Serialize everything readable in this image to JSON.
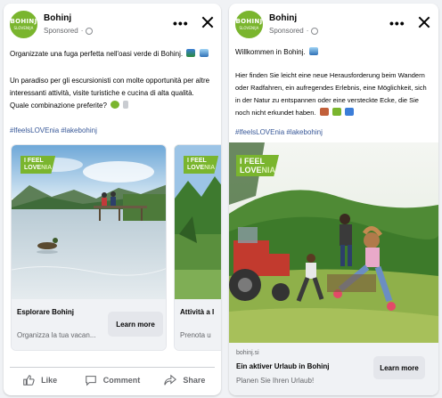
{
  "colors": {
    "brand": "#7ab52e",
    "hashtag": "#385898",
    "secondary_text": "#65676b",
    "button_bg": "#e4e6eb"
  },
  "left_post": {
    "page_name": "Bohinj",
    "sponsored": "Sponsored",
    "logo": {
      "line1": "BOHINJ",
      "line2": "SLOVENIJA"
    },
    "text_line1": "Organizzate una fuga perfetta nell'oasi verde di Bohinj.",
    "text_p2_line1": "Un paradiso per gli escursionisti con molte opportunità per altre",
    "text_p2_line2": "interessanti attività, visite turistiche e cucina di alta qualità.",
    "text_p2_line3": "Quale combinazione preferite?",
    "hashtags": "#lfeelsLOVEnia #lakebohinj",
    "carousel": [
      {
        "title": "Esplorare Bohinj",
        "description": "Organizza la tua vacan...",
        "button": "Learn more",
        "badge_line1": "I FEEL",
        "badge_line2_a": "LOVE",
        "badge_line2_b": "NIA"
      },
      {
        "title": "Attività a I",
        "description": "Prenota u",
        "badge_line1": "I FEEL",
        "badge_line2_a": "LOVE",
        "badge_line2_b": "NIA"
      }
    ],
    "actions": {
      "like": "Like",
      "comment": "Comment",
      "share": "Share"
    }
  },
  "right_post": {
    "page_name": "Bohinj",
    "sponsored": "Sponsored",
    "logo": {
      "line1": "BOHINJ",
      "line2": "SLOVENIJA"
    },
    "text_line1": "Willkommen in Bohinj.",
    "text_p2_line1": "Hier finden Sie leicht eine neue Herausforderung beim Wandern",
    "text_p2_line2": "oder Radfahren, ein aufregendes Erlebnis, eine Möglichkeit, sich",
    "text_p2_line3": "in der Natur zu entspannen oder eine versteckte Ecke, die Sie",
    "text_p2_line4": "noch nicht erkundet haben.",
    "hashtags": "#lfeelsLOVEnia #lakebohinj",
    "ad": {
      "domain": "bohinj.si",
      "title": "Ein aktiver Urlaub in Bohinj",
      "description": "Planen Sie Ihren Urlaub!",
      "button": "Learn more",
      "badge_line1": "I FEEL",
      "badge_line2_a": "LOVE",
      "badge_line2_b": "NIA"
    }
  }
}
